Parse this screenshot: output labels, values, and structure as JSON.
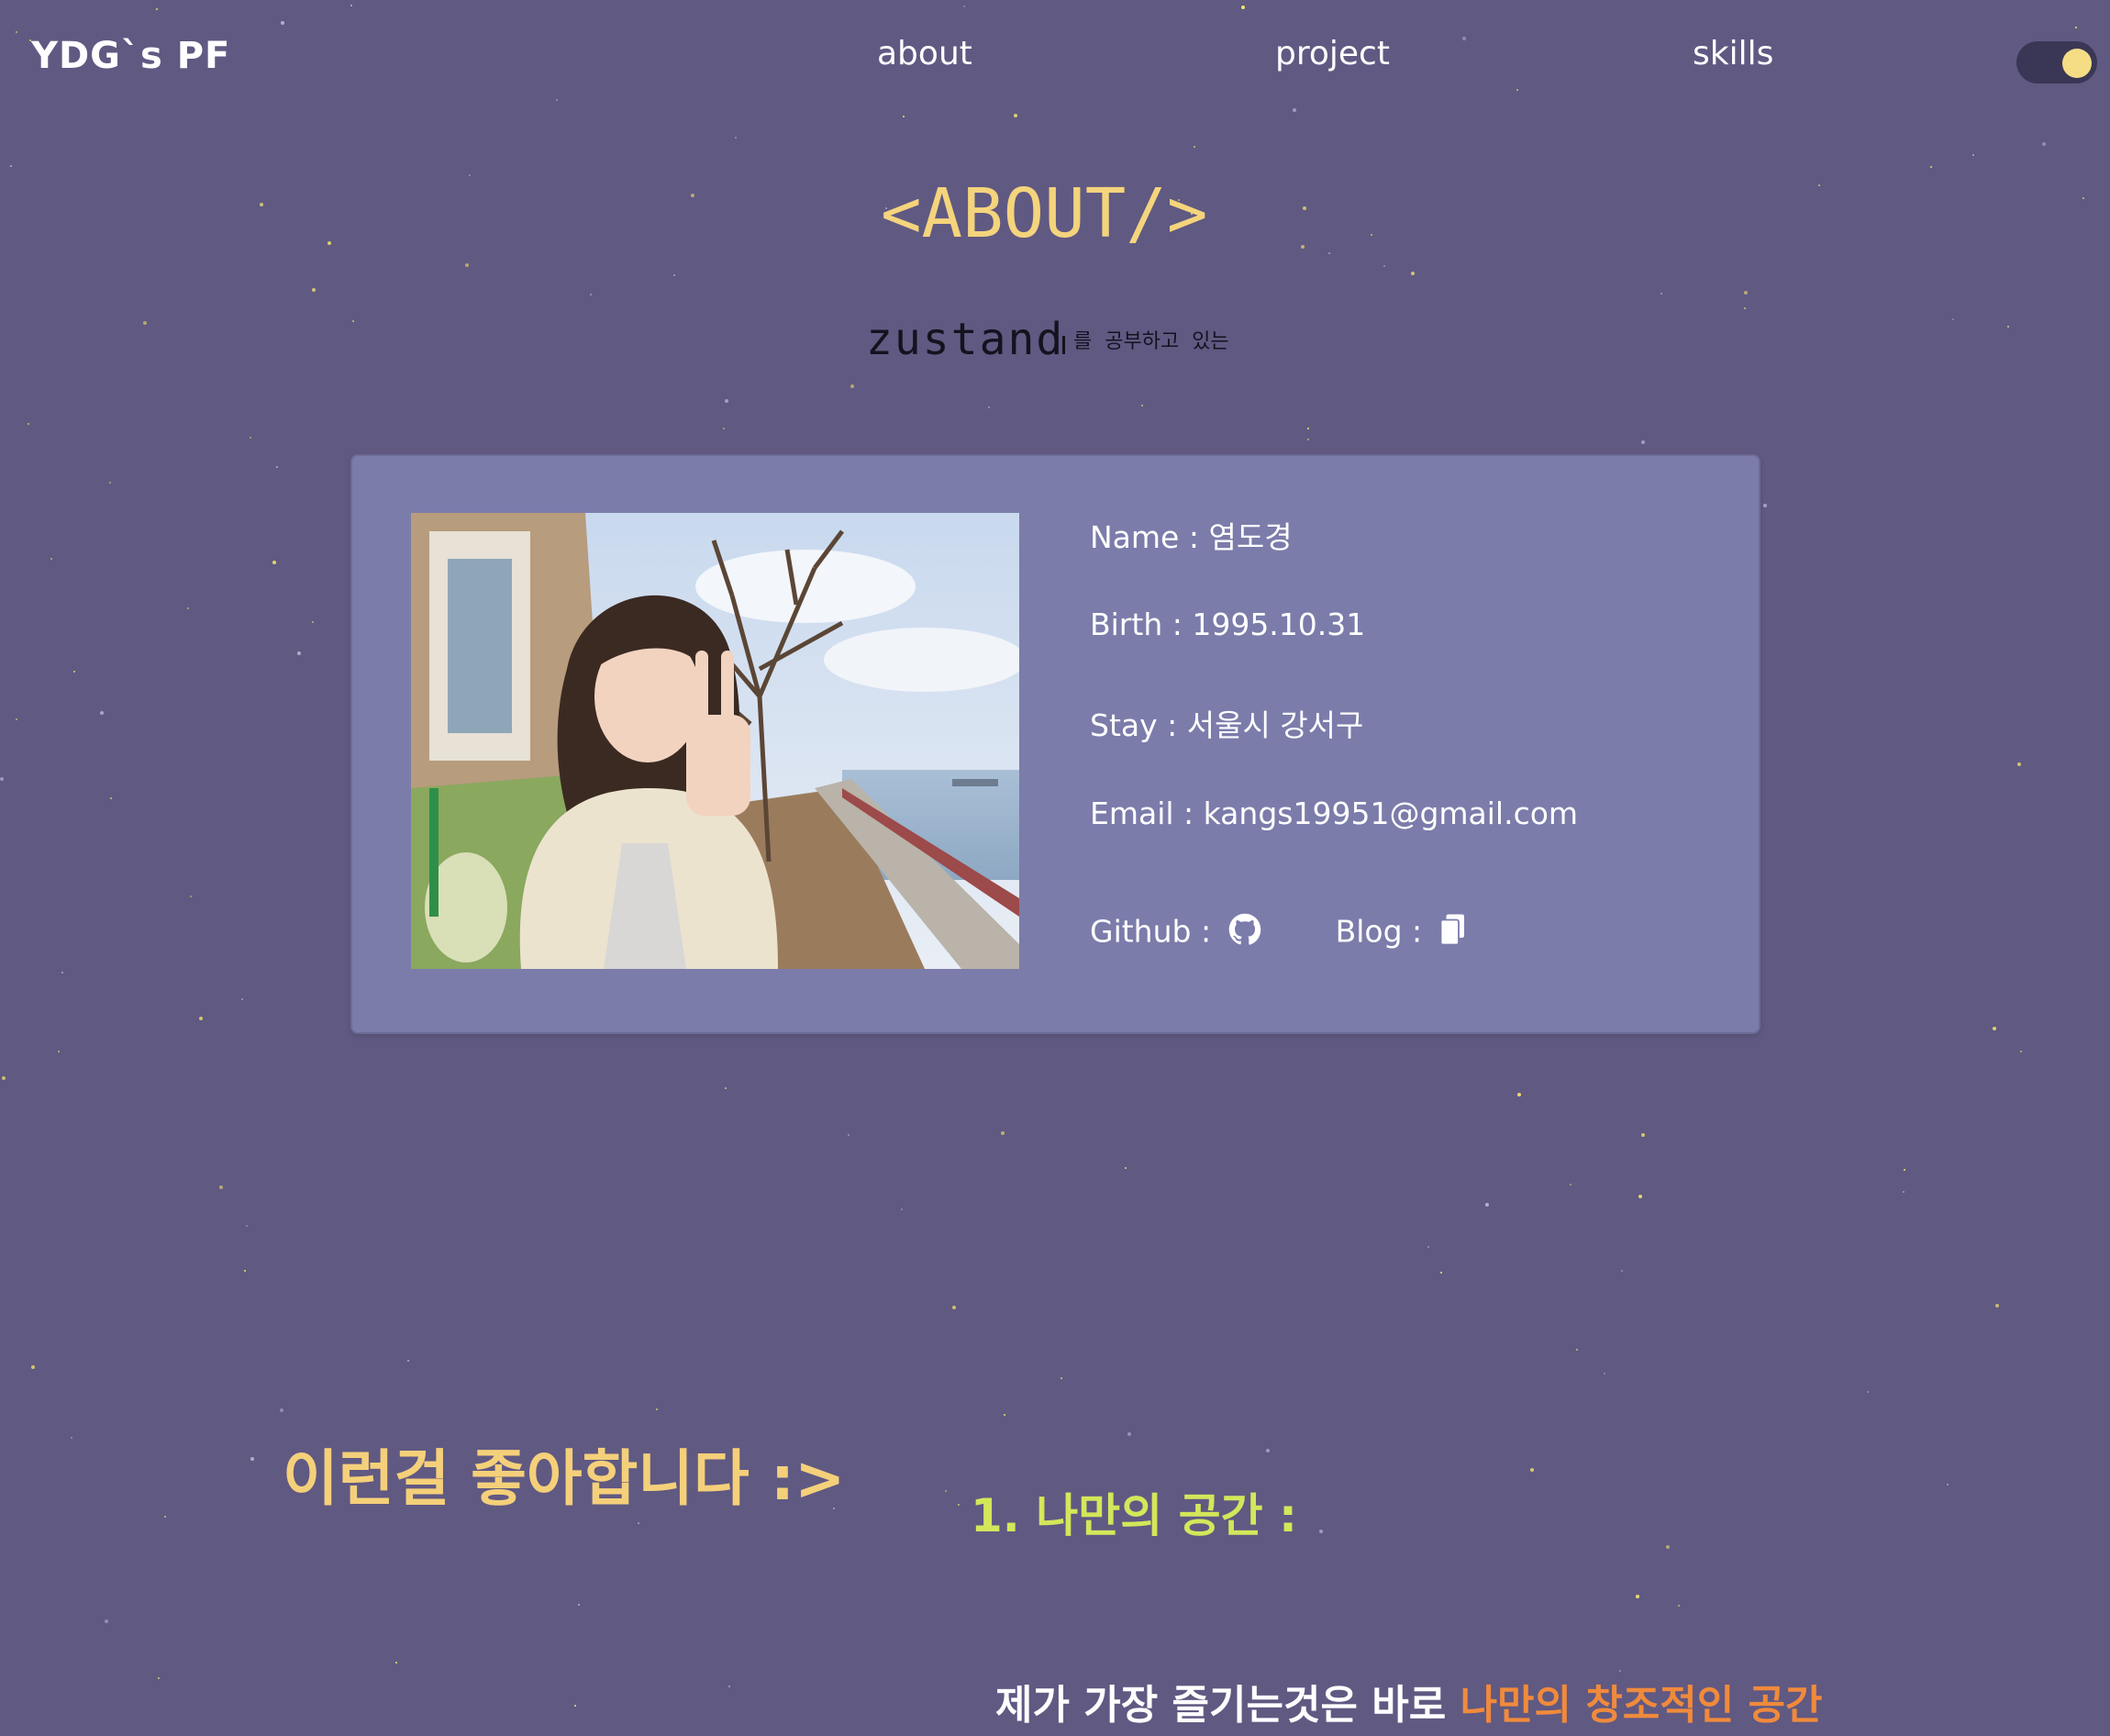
{
  "nav": {
    "logo": "YDG`s PF",
    "links": [
      "about",
      "project",
      "skills"
    ],
    "theme_toggle": {
      "state": "on",
      "knob_color": "#f5dd86"
    }
  },
  "about": {
    "title": "<ABOUT/>",
    "typing": {
      "word": "zustand",
      "rest": "를  공부하고  있는"
    }
  },
  "profile": {
    "photo_alt": "profile photo",
    "rows": [
      {
        "key": "Name : ",
        "value": "염도경"
      },
      {
        "key": "Birth : ",
        "value": "1995.10.31"
      },
      {
        "key": "Stay : ",
        "value": "서울시 강서구"
      },
      {
        "key": "Email : ",
        "value": "kangs19951@gmail.com"
      }
    ],
    "github_label": "Github :",
    "blog_label": "Blog :",
    "github_icon": "github-icon",
    "blog_icon": "document-icon"
  },
  "likes": {
    "title": "이런걸 좋아합니다 :>",
    "item_title": "1. 나만의 공간 :",
    "desc_prefix": "제가 가장 즐기는것은 바로 ",
    "desc_highlight": "나만의 창조적인 공간"
  },
  "colors": {
    "background": "#605982",
    "card": "#7b7caa",
    "title_accent": "#f4d47c",
    "item_accent": "#d4e75a",
    "highlight": "#f08a3c"
  }
}
